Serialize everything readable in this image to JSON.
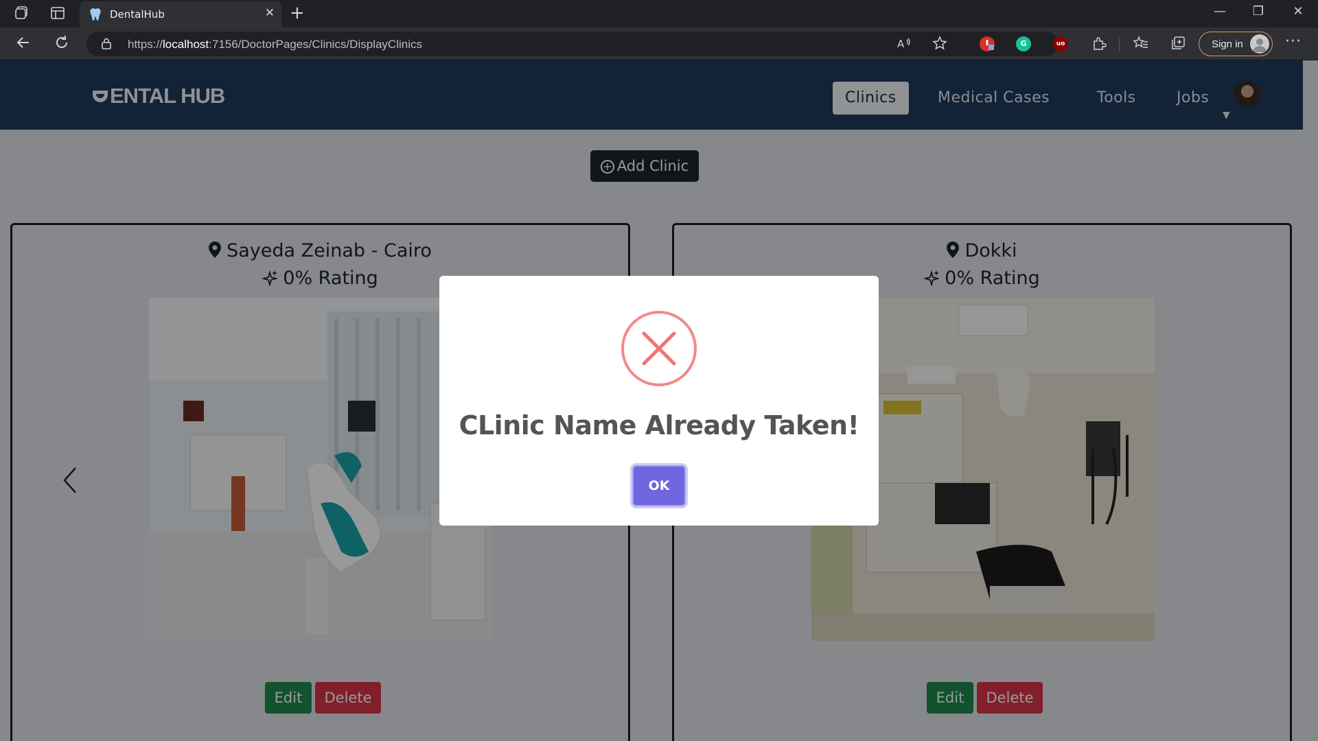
{
  "browser": {
    "tab_title": "DentalHub",
    "tab_close": "✕",
    "new_tab": "+",
    "url_scheme": "https://",
    "url_host": "localhost",
    "url_path": ":7156/DoctorPages/Clinics/DisplayClinics",
    "signin_label": "Sign in",
    "more": "···",
    "window_controls": [
      "—",
      "❐",
      "✕"
    ],
    "extensions": [
      {
        "name": "adblock-icon",
        "glyph": "",
        "color": "#d93025"
      },
      {
        "name": "grammarly-icon",
        "glyph": "G",
        "color": "#15c39a"
      },
      {
        "name": "ublock-icon",
        "glyph": "uo",
        "color": "#8b0000"
      }
    ]
  },
  "site": {
    "logo": "ENTAL HUB",
    "nav": [
      {
        "label": "Clinics",
        "active": true
      },
      {
        "label": "Medical Cases",
        "active": false
      },
      {
        "label": "Tools",
        "active": false
      },
      {
        "label": "Jobs",
        "active": false
      }
    ],
    "add_clinic_label": "Add Clinic",
    "add_clinic_icon": "+"
  },
  "clinics": [
    {
      "location": "Sayeda Zeinab - Cairo",
      "rating": "0% Rating",
      "edit": "Edit",
      "delete": "Delete"
    },
    {
      "location": "Dokki",
      "rating": "0% Rating",
      "edit": "Edit",
      "delete": "Delete"
    }
  ],
  "modal": {
    "title": "CLinic Name Already Taken!",
    "ok_label": "OK",
    "icon_color": "#f27474",
    "button_color": "#7066e0"
  }
}
